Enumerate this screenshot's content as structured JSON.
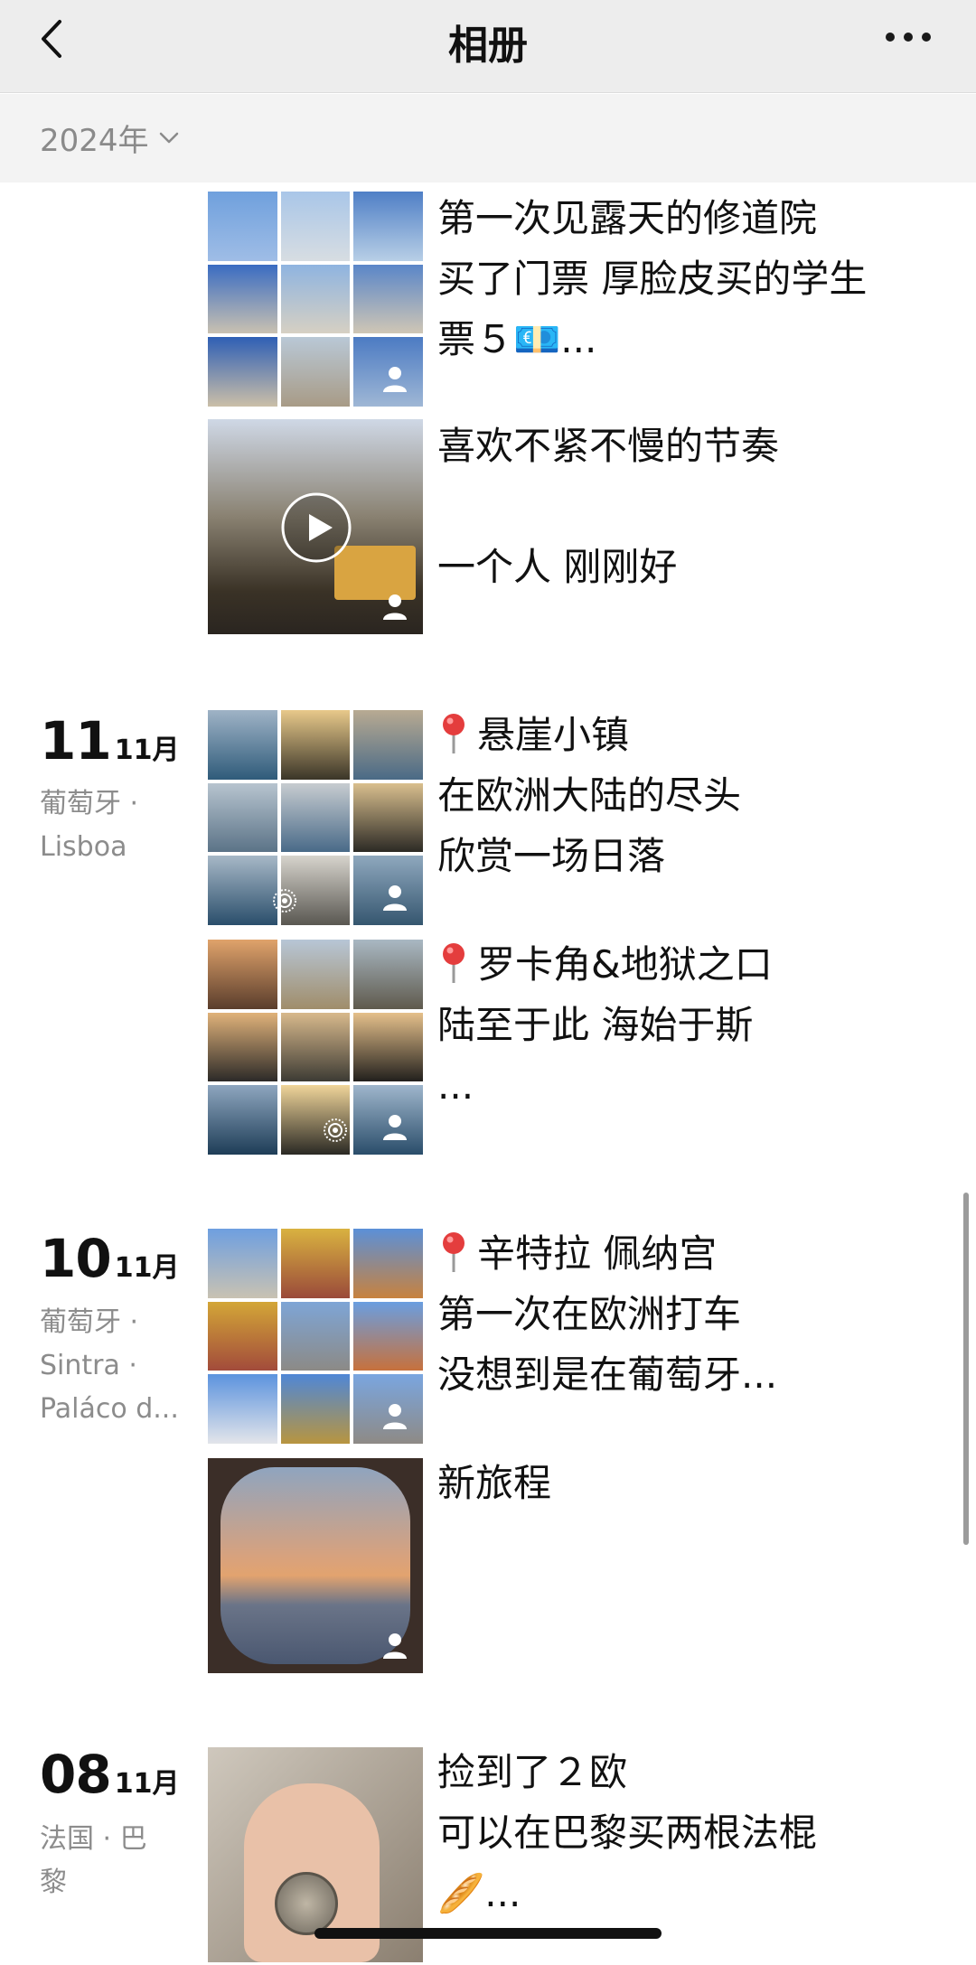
{
  "nav": {
    "title": "相册"
  },
  "year_filter": {
    "label": "2024年"
  },
  "entries": [
    {
      "posts": [
        {
          "kind": "grid9",
          "text": [
            "第一次见露天的修道院",
            "买了门票 厚脸皮买的学生",
            "票５💶..."
          ]
        },
        {
          "kind": "video",
          "text": [
            "喜欢不紧不慢的节奏",
            "",
            "一个人 刚刚好"
          ]
        }
      ]
    },
    {
      "date": {
        "day": "11",
        "month": "11月"
      },
      "place": [
        "葡萄牙 ·",
        "Lisboa"
      ],
      "posts": [
        {
          "kind": "grid9",
          "text": [
            "悬崖小镇",
            "在欧洲大陆的尽头",
            "欣赏一场日落"
          ]
        },
        {
          "kind": "grid9",
          "text": [
            "罗卡角&地狱之口",
            "陆至于此 海始于斯",
            "..."
          ]
        }
      ]
    },
    {
      "date": {
        "day": "10",
        "month": "11月"
      },
      "place": [
        "葡萄牙 ·",
        "Sintra ·",
        "Paláco d..."
      ],
      "posts": [
        {
          "kind": "grid9",
          "text": [
            "辛特拉 佩纳宫",
            "第一次在欧洲打车",
            "没想到是在葡萄牙..."
          ]
        },
        {
          "kind": "single",
          "text": [
            "新旅程"
          ]
        }
      ]
    },
    {
      "date": {
        "day": "08",
        "month": "11月"
      },
      "place": [
        "法国 · 巴",
        "黎"
      ],
      "posts": [
        {
          "kind": "single",
          "text": [
            "捡到了２欧",
            "可以在巴黎买两根法棍",
            "🥖..."
          ]
        }
      ]
    }
  ],
  "icons": {
    "back": "back-chevron-icon",
    "more": "more-dots-icon",
    "dropdown": "chevron-down-icon",
    "location": "location-pin-icon",
    "visibility": "person-visibility-icon",
    "play": "play-icon",
    "live": "live-photo-icon"
  },
  "colors": {
    "nav_bg": "#ededed",
    "year_bg": "#f3f3f3",
    "muted_text": "#8c8c8c",
    "pin_red": "#e43d3d"
  }
}
